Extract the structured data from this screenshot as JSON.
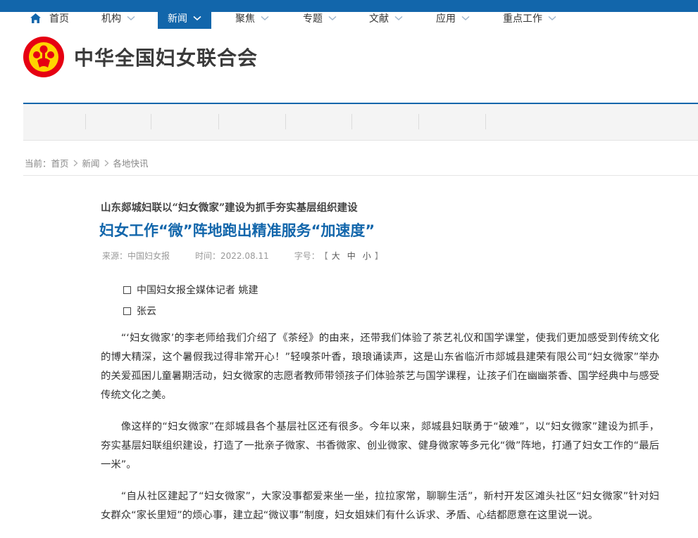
{
  "site": {
    "name": "中华全国妇女联合会"
  },
  "nav": {
    "items": [
      {
        "label": "首页"
      },
      {
        "label": "机构"
      },
      {
        "label": "新闻"
      },
      {
        "label": "聚焦"
      },
      {
        "label": "专题"
      },
      {
        "label": "文献"
      },
      {
        "label": "应用"
      },
      {
        "label": "重点工作"
      }
    ]
  },
  "breadcrumb": {
    "prefix": "当前：",
    "items": [
      "首页",
      "新闻",
      "各地快讯"
    ]
  },
  "article": {
    "pretitle": "山东郯城妇联以“妇女微家”建设为抓手夯实基层组织建设",
    "title": "妇女工作“微”阵地跑出精准服务“加速度”",
    "source": "来源：中国妇女报",
    "time": "时间：2022.08.11",
    "fontsize_label": "字号：",
    "bracket_open": "【",
    "bracket_close": "】",
    "fs_large": "大",
    "fs_medium": "中",
    "fs_small": "小",
    "authors": [
      "中国妇女报全媒体记者 姚建",
      "张云"
    ],
    "paragraphs": [
      "“‘妇女微家’的李老师给我们介绍了《茶经》的由来，还带我们体验了茶艺礼仪和国学课堂，使我们更加感受到传统文化的博大精深，这个暑假我过得非常开心！”轻嗅茶叶香，琅琅诵读声，这是山东省临沂市郯城县建荣有限公司“妇女微家”举办的关爱孤困儿童暑期活动，妇女微家的志愿者教师带领孩子们体验茶艺与国学课程，让孩子们在幽幽茶香、国学经典中与感受传统文化之美。",
      "像这样的“妇女微家”在郯城县各个基层社区还有很多。今年以来，郯城县妇联勇于“破难”，以“妇女微家”建设为抓手，夯实基层妇联组织建设，打造了一批亲子微家、书香微家、创业微家、健身微家等多元化“微”阵地，打通了妇女工作的“最后一米”。",
      "“自从社区建起了“妇女微家”，大家没事都爱来坐一坐，拉拉家常，聊聊生活”，新村开发区滩头社区“妇女微家”针对妇女群众“家长里短”的烦心事，建立起“微议事”制度，妇女姐妹们有什么诉求、矛盾、心结都愿意在这里说一说。"
    ]
  },
  "colors": {
    "brand": "#1266ab",
    "emblem_red": "#e60012",
    "emblem_yellow": "#ffd400"
  }
}
